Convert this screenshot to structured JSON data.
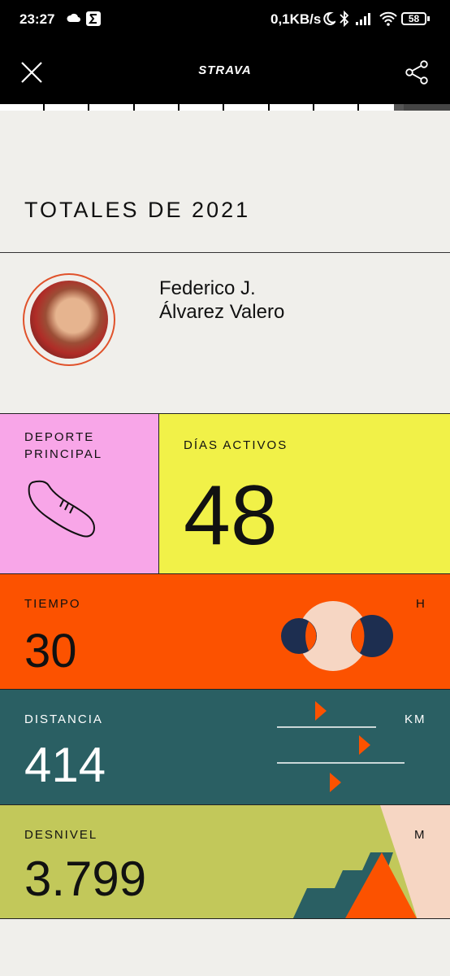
{
  "status_bar": {
    "time": "23:27",
    "speed": "0,1KB/s",
    "battery": "58"
  },
  "header": {
    "brand": "STRAVA"
  },
  "title": "TOTALES DE 2021",
  "profile": {
    "name_line1": "Federico J.",
    "name_line2": "Álvarez Valero"
  },
  "stats": {
    "sport": {
      "label_line1": "DEPORTE",
      "label_line2": "PRINCIPAL",
      "icon": "shoe-icon"
    },
    "active_days": {
      "label": "DÍAS ACTIVOS",
      "value": "48"
    },
    "time": {
      "label": "TIEMPO",
      "unit": "H",
      "value": "30"
    },
    "distance": {
      "label": "DISTANCIA",
      "unit": "KM",
      "value": "414"
    },
    "elevation": {
      "label": "DESNIVEL",
      "unit": "M",
      "value": "3.799"
    }
  },
  "colors": {
    "pink": "#f8a6e8",
    "yellow": "#f1f148",
    "orange": "#fc5200",
    "teal": "#2a5f63",
    "olive": "#c2c85a",
    "peach": "#f6d6c3",
    "navy": "#1d2e50"
  }
}
